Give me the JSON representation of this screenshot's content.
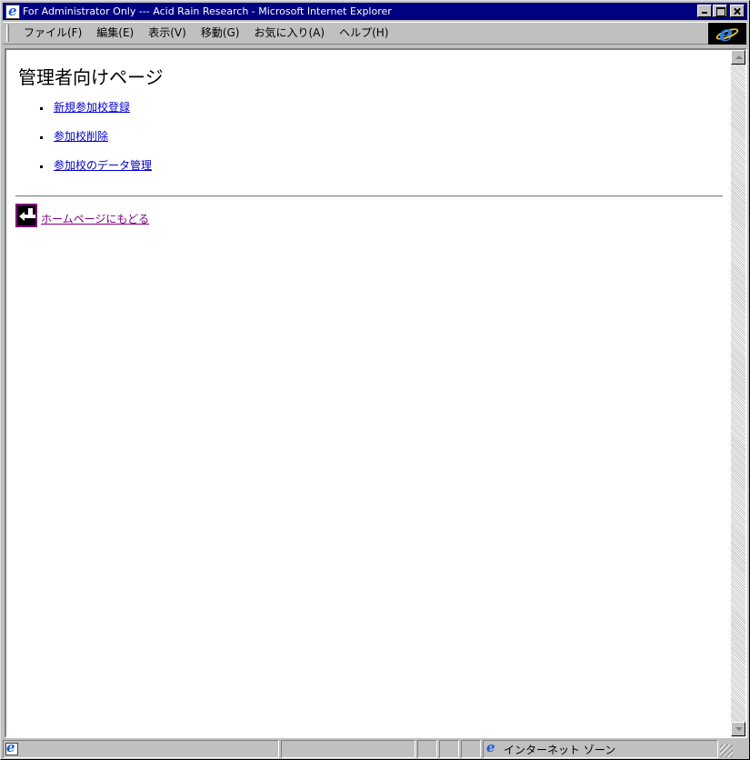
{
  "window": {
    "title": "For Administrator Only --- Acid Rain Research - Microsoft Internet Explorer"
  },
  "menu": {
    "items": [
      {
        "label": "ファイル(F)"
      },
      {
        "label": "編集(E)"
      },
      {
        "label": "表示(V)"
      },
      {
        "label": "移動(G)"
      },
      {
        "label": "お気に入り(A)"
      },
      {
        "label": "ヘルプ(H)"
      }
    ]
  },
  "page": {
    "title": "管理者向けページ",
    "links": [
      {
        "label": "新規参加校登録"
      },
      {
        "label": "参加校削除"
      },
      {
        "label": "参加校のデータ管理"
      }
    ],
    "back_link": {
      "label": "ホームページにもどる",
      "icon": "return-arrow-icon"
    }
  },
  "statusbar": {
    "zone": "インターネット ゾーン"
  },
  "colors": {
    "titlebar": "#000080",
    "link": "#0000cc",
    "visited_link": "#800080",
    "chrome": "#c0c0c0"
  }
}
